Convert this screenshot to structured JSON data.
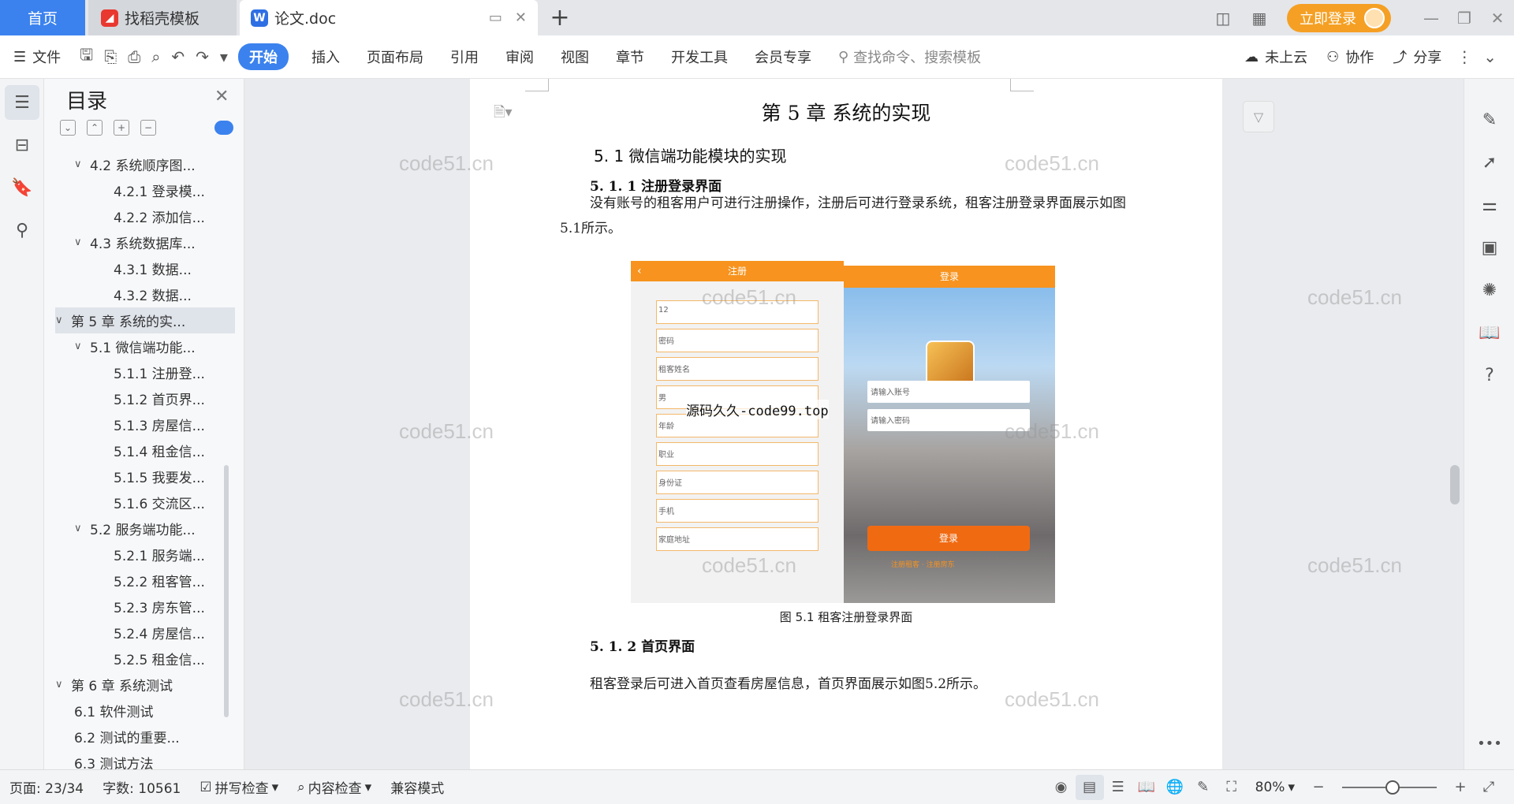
{
  "tabs": {
    "home": "首页",
    "daoke": "找稻壳模板",
    "doc": "论文.doc",
    "add_icon": "plus-icon"
  },
  "titlebar": {
    "login": "立即登录"
  },
  "ribbon": {
    "file": "文件",
    "start": "开始",
    "insert": "插入",
    "layout": "页面布局",
    "reference": "引用",
    "review": "审阅",
    "view": "视图",
    "chapter": "章节",
    "devtools": "开发工具",
    "member": "会员专享",
    "search": "查找命令、搜索模板",
    "cloud": "未上云",
    "collab": "协作",
    "share": "分享"
  },
  "toc": {
    "title": "目录",
    "items": [
      {
        "label": "4.2 系统顺序图...",
        "level": 2,
        "expand": true
      },
      {
        "label": "4.2.1 登录模...",
        "level": 3
      },
      {
        "label": "4.2.2 添加信...",
        "level": 3
      },
      {
        "label": "4.3 系统数据库...",
        "level": 2,
        "expand": true
      },
      {
        "label": "4.3.1  数据...",
        "level": 3
      },
      {
        "label": "4.3.2  数据...",
        "level": 3
      },
      {
        "label": "第 5 章  系统的实...",
        "level": 1,
        "expand": true,
        "active": true
      },
      {
        "label": "5.1 微信端功能...",
        "level": 2,
        "expand": true
      },
      {
        "label": "5.1.1 注册登...",
        "level": 3
      },
      {
        "label": "5.1.2 首页界...",
        "level": 3
      },
      {
        "label": "5.1.3 房屋信...",
        "level": 3
      },
      {
        "label": "5.1.4 租金信...",
        "level": 3
      },
      {
        "label": "5.1.5 我要发...",
        "level": 3
      },
      {
        "label": "5.1.6 交流区...",
        "level": 3
      },
      {
        "label": "5.2 服务端功能...",
        "level": 2,
        "expand": true
      },
      {
        "label": "5.2.1 服务端...",
        "level": 3
      },
      {
        "label": "5.2.2 租客管...",
        "level": 3
      },
      {
        "label": "5.2.3 房东管...",
        "level": 3
      },
      {
        "label": "5.2.4 房屋信...",
        "level": 3
      },
      {
        "label": "5.2.5 租金信...",
        "level": 3
      },
      {
        "label": "第 6 章  系统测试",
        "level": 1,
        "expand": true
      },
      {
        "label": "6.1  软件测试",
        "level": 2
      },
      {
        "label": "6.2  测试的重要...",
        "level": 2
      },
      {
        "label": "6.3  测试方法",
        "level": 2
      }
    ]
  },
  "doc": {
    "chapter_title": "第 5 章  系统的实现",
    "section_title": "5. 1 微信端功能模块的实现",
    "sub1": "5. 1. 1 注册登录界面",
    "para1": "没有账号的租客用户可进行注册操作，注册后可进行登录系统，租客注册登录界面展示如图5.1所示。",
    "figure": {
      "reg_title": "注册",
      "reg_fields": [
        "12",
        "密码",
        "租客姓名",
        "男",
        "年龄",
        "职业",
        "身份证",
        "手机",
        "家庭地址"
      ],
      "login_title": "登录",
      "login_account": "请输入账号",
      "login_password": "请输入密码",
      "login_button": "登录",
      "login_links": "注册租客 · 注册房东",
      "overlay": "源码久久-code99.top",
      "caption": "图 5.1  租客注册登录界面"
    },
    "sub2": "5. 1. 2 首页界面",
    "para2": "租客登录后可进入首页查看房屋信息，首页界面展示如图5.2所示。",
    "watermark": "code51.cn"
  },
  "status": {
    "page": "页面: 23/34",
    "words": "字数: 10561",
    "spell": "拼写检查",
    "content": "内容检查",
    "compat": "兼容模式",
    "zoom": "80%"
  },
  "colors": {
    "accent": "#3b82ee",
    "login": "#f5a024",
    "figure_orange": "#f7931e"
  }
}
